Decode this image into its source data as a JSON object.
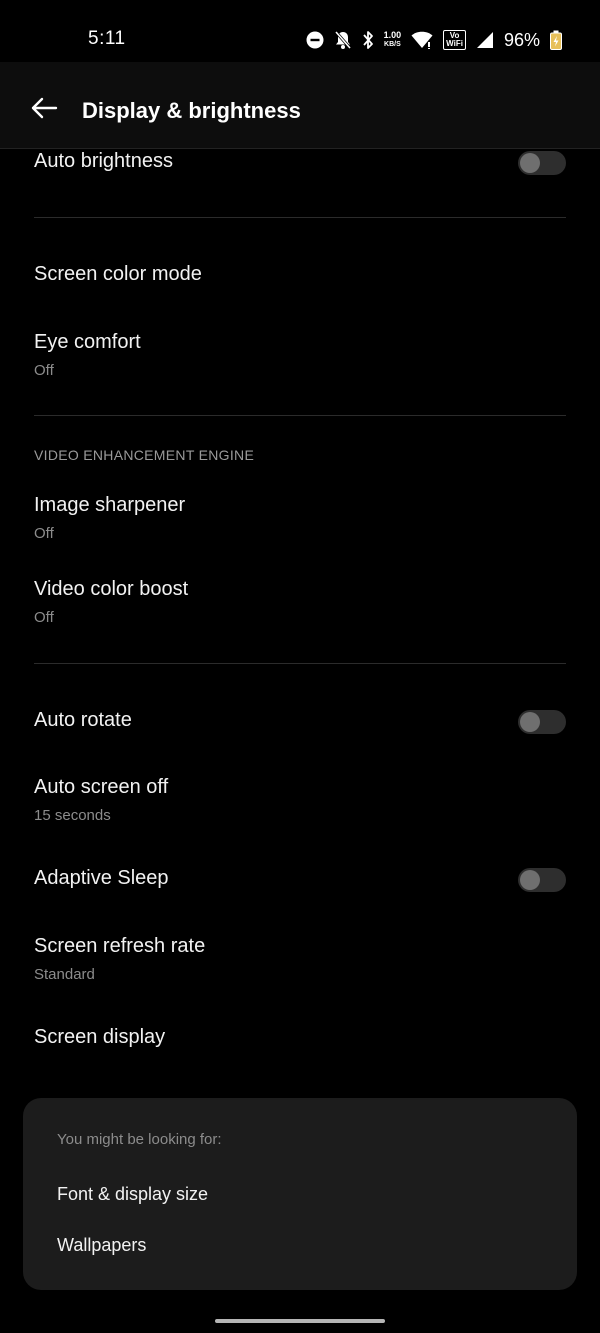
{
  "status_bar": {
    "time": "5:11",
    "net_speed_value": "1.00",
    "net_speed_unit": "KB/S",
    "volte_top": "Vo",
    "volte_bottom": "WiFi",
    "battery_percent": "96%"
  },
  "header": {
    "title": "Display & brightness"
  },
  "settings": {
    "auto_brightness": {
      "title": "Auto brightness"
    },
    "screen_color_mode": {
      "title": "Screen color mode"
    },
    "eye_comfort": {
      "title": "Eye comfort",
      "value": "Off"
    },
    "video_section_header": "VIDEO ENHANCEMENT ENGINE",
    "image_sharpener": {
      "title": "Image sharpener",
      "value": "Off"
    },
    "video_color_boost": {
      "title": "Video color boost",
      "value": "Off"
    },
    "auto_rotate": {
      "title": "Auto rotate"
    },
    "auto_screen_off": {
      "title": "Auto screen off",
      "value": "15 seconds"
    },
    "adaptive_sleep": {
      "title": "Adaptive Sleep"
    },
    "screen_refresh_rate": {
      "title": "Screen refresh rate",
      "value": "Standard"
    },
    "screen_display": {
      "title": "Screen display"
    }
  },
  "suggestions": {
    "heading": "You might be looking for:",
    "items": [
      "Font & display size",
      "Wallpapers"
    ]
  },
  "colors": {
    "background": "#000000",
    "card": "#1c1c1c",
    "toggle_track_off": "#2e2e2e",
    "toggle_knob_off": "#6f6f6f"
  }
}
